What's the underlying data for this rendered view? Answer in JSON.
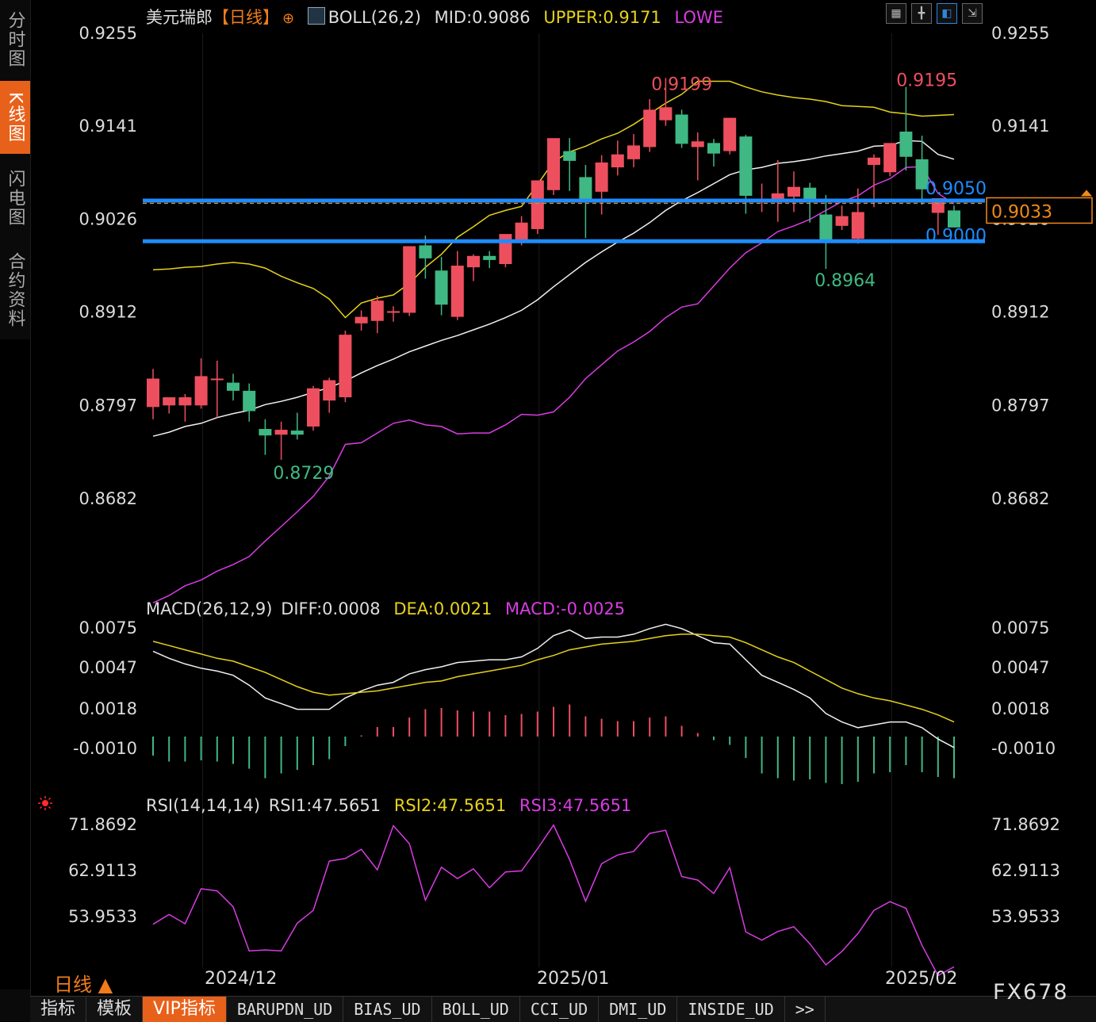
{
  "sidebar": {
    "tabs": [
      {
        "label": "分时图",
        "active": false
      },
      {
        "label": "K线图",
        "active": true
      },
      {
        "label": "闪电图",
        "active": false
      },
      {
        "label": "合约资料",
        "active": false
      }
    ]
  },
  "header": {
    "symbol": "美元瑞郎",
    "period_tag": "【日线】",
    "boll": "BOLL(26,2)",
    "mid": "MID:0.9086",
    "upper": "UPPER:0.9171",
    "lower": "LOWE"
  },
  "macd_legend": {
    "name": "MACD(26,12,9)",
    "diff": "DIFF:0.0008",
    "dea": "DEA:0.0021",
    "macd": "MACD:-0.0025"
  },
  "rsi_legend": {
    "name": "RSI(14,14,14)",
    "rsi1": "RSI1:47.5651",
    "rsi2": "RSI2:47.5651",
    "rsi3": "RSI3:47.5651"
  },
  "toolbar_icons": [
    "grid-icon",
    "crosshair-icon",
    "chart-mode-icon",
    "exit-fullscreen-icon"
  ],
  "bottom_tabs": [
    "指标",
    "模板",
    "VIP指标",
    "BARUPDN_UD",
    "BIAS_UD",
    "BOLL_UD",
    "CCI_UD",
    "DMI_UD",
    "INSIDE_UD",
    ">>"
  ],
  "period_label": "日线 ▲",
  "brand": "FX678",
  "colors": {
    "up": "#ee4f5e",
    "down": "#3fb883",
    "upper": "#e6d21a",
    "mid": "#f0f0f0",
    "lower": "#d93ce3",
    "hline": "#1e8cff",
    "accent": "#e8611a"
  },
  "chart_data": [
    {
      "type": "candlestick",
      "title": "美元瑞郎 日线",
      "y_ticks": [
        0.9255,
        0.9141,
        0.9026,
        0.8912,
        0.8797,
        0.8682
      ],
      "ylim": [
        0.8565,
        0.9255
      ],
      "x_labels": [
        "2024/12",
        "2025/01",
        "2025/02"
      ],
      "candles": [
        [
          0.8794,
          0.8841,
          0.8779,
          0.8829
        ],
        [
          0.8796,
          0.8804,
          0.8786,
          0.8806
        ],
        [
          0.8796,
          0.881,
          0.8776,
          0.8806
        ],
        [
          0.8796,
          0.8854,
          0.8792,
          0.8832
        ],
        [
          0.8828,
          0.8851,
          0.8781,
          0.8829
        ],
        [
          0.8824,
          0.8835,
          0.8802,
          0.8814
        ],
        [
          0.8814,
          0.8823,
          0.8776,
          0.8789
        ],
        [
          0.8767,
          0.8779,
          0.8735,
          0.8759
        ],
        [
          0.876,
          0.8776,
          0.8729,
          0.8766
        ],
        [
          0.8765,
          0.8787,
          0.8754,
          0.876
        ],
        [
          0.877,
          0.882,
          0.8765,
          0.8817
        ],
        [
          0.8802,
          0.883,
          0.8787,
          0.8827
        ],
        [
          0.8806,
          0.8888,
          0.88,
          0.8883
        ],
        [
          0.8897,
          0.8913,
          0.8888,
          0.8905
        ],
        [
          0.89,
          0.8931,
          0.8885,
          0.8925
        ],
        [
          0.891,
          0.8918,
          0.8899,
          0.8912
        ],
        [
          0.891,
          0.8978,
          0.8906,
          0.8992
        ],
        [
          0.8993,
          0.9005,
          0.8952,
          0.8977
        ],
        [
          0.8962,
          0.8979,
          0.8907,
          0.892
        ],
        [
          0.8905,
          0.8986,
          0.8901,
          0.8968
        ],
        [
          0.8966,
          0.8982,
          0.8949,
          0.898
        ],
        [
          0.898,
          0.8986,
          0.8965,
          0.8975
        ],
        [
          0.897,
          0.9002,
          0.8966,
          0.9007
        ],
        [
          0.9,
          0.9029,
          0.8993,
          0.9021
        ],
        [
          0.9013,
          0.9053,
          0.9007,
          0.9073
        ],
        [
          0.9061,
          0.912,
          0.9055,
          0.9125
        ],
        [
          0.9109,
          0.9125,
          0.906,
          0.9097
        ],
        [
          0.9077,
          0.9092,
          0.9002,
          0.905
        ],
        [
          0.9059,
          0.9104,
          0.9031,
          0.9095
        ],
        [
          0.9089,
          0.9122,
          0.9079,
          0.9105
        ],
        [
          0.9099,
          0.913,
          0.9089,
          0.9116
        ],
        [
          0.9114,
          0.9173,
          0.9108,
          0.916
        ],
        [
          0.9147,
          0.9199,
          0.914,
          0.9163
        ],
        [
          0.9154,
          0.916,
          0.9113,
          0.9118
        ],
        [
          0.9114,
          0.9132,
          0.9073,
          0.9121
        ],
        [
          0.9119,
          0.9124,
          0.909,
          0.9106
        ],
        [
          0.9109,
          0.915,
          0.9105,
          0.915
        ],
        [
          0.9127,
          0.9129,
          0.9032,
          0.9054
        ],
        [
          0.9047,
          0.9069,
          0.9034,
          0.9049
        ],
        [
          0.9046,
          0.9098,
          0.9022,
          0.9057
        ],
        [
          0.9053,
          0.9084,
          0.9034,
          0.9065
        ],
        [
          0.9064,
          0.907,
          0.9021,
          0.905
        ],
        [
          0.9031,
          0.9055,
          0.8964,
          0.9
        ],
        [
          0.9017,
          0.9042,
          0.9012,
          0.9029
        ],
        [
          0.9001,
          0.9063,
          0.8995,
          0.9034
        ],
        [
          0.9092,
          0.9105,
          0.904,
          0.9101
        ],
        [
          0.9083,
          0.9108,
          0.9078,
          0.9119
        ],
        [
          0.9133,
          0.9188,
          0.9085,
          0.9102
        ],
        [
          0.9099,
          0.9128,
          0.9043,
          0.9062
        ],
        [
          0.9033,
          0.9051,
          0.9006,
          0.9051
        ],
        [
          0.9036,
          0.9042,
          0.9018,
          0.9015
        ]
      ],
      "boll_upper": [
        0.8963,
        0.8964,
        0.8966,
        0.8967,
        0.897,
        0.8972,
        0.897,
        0.8965,
        0.8955,
        0.8947,
        0.894,
        0.8927,
        0.8904,
        0.8922,
        0.8928,
        0.8932,
        0.8946,
        0.8966,
        0.8982,
        0.9003,
        0.9016,
        0.903,
        0.9036,
        0.9041,
        0.9068,
        0.9096,
        0.9108,
        0.9115,
        0.9124,
        0.9131,
        0.9142,
        0.9155,
        0.9168,
        0.9179,
        0.9195,
        0.9195,
        0.9195,
        0.9188,
        0.9182,
        0.9178,
        0.9175,
        0.9173,
        0.917,
        0.9165,
        0.9164,
        0.9163,
        0.9157,
        0.9155,
        0.9152,
        0.9153,
        0.9154
      ],
      "boll_mid": [
        0.8758,
        0.8763,
        0.877,
        0.8774,
        0.8781,
        0.8786,
        0.879,
        0.8797,
        0.8801,
        0.8806,
        0.8812,
        0.8818,
        0.8826,
        0.8836,
        0.8845,
        0.8853,
        0.8862,
        0.8869,
        0.8876,
        0.8882,
        0.8889,
        0.8896,
        0.8904,
        0.8913,
        0.8926,
        0.8942,
        0.8957,
        0.8972,
        0.8985,
        0.8997,
        0.9008,
        0.9021,
        0.9036,
        0.9048,
        0.9058,
        0.9069,
        0.908,
        0.9086,
        0.9089,
        0.9094,
        0.9096,
        0.9099,
        0.9103,
        0.9106,
        0.9109,
        0.9115,
        0.9116,
        0.9122,
        0.9121,
        0.9105,
        0.9099
      ]
    },
    {
      "type": "line",
      "title": "MACD(26,12,9)",
      "y_ticks": [
        0.0075,
        0.0047,
        0.0018,
        -0.001
      ],
      "diff": [
        0.0058,
        0.0053,
        0.0049,
        0.0046,
        0.0044,
        0.0041,
        0.0034,
        0.0025,
        0.0021,
        0.0017,
        0.0017,
        0.0017,
        0.0025,
        0.003,
        0.0034,
        0.0036,
        0.0042,
        0.0045,
        0.0047,
        0.005,
        0.0051,
        0.0052,
        0.0052,
        0.0054,
        0.006,
        0.0069,
        0.0073,
        0.0067,
        0.0068,
        0.0068,
        0.007,
        0.0074,
        0.0077,
        0.0074,
        0.0069,
        0.0064,
        0.0063,
        0.0052,
        0.0041,
        0.0036,
        0.0031,
        0.0025,
        0.0014,
        0.0008,
        0.0004,
        0.0006,
        0.0008,
        0.0008,
        0.0004,
        -0.0004,
        -0.001
      ],
      "dea": [
        0.0065,
        0.0062,
        0.0059,
        0.0056,
        0.0053,
        0.0051,
        0.0047,
        0.0043,
        0.0038,
        0.0033,
        0.0029,
        0.0027,
        0.0028,
        0.0029,
        0.003,
        0.0032,
        0.0034,
        0.0036,
        0.0037,
        0.004,
        0.0042,
        0.0044,
        0.0046,
        0.0048,
        0.0052,
        0.0055,
        0.0059,
        0.0061,
        0.0063,
        0.0064,
        0.0065,
        0.0067,
        0.0069,
        0.007,
        0.007,
        0.0069,
        0.0068,
        0.0064,
        0.0059,
        0.0054,
        0.005,
        0.0044,
        0.0038,
        0.0032,
        0.0028,
        0.0025,
        0.0023,
        0.002,
        0.0017,
        0.0013,
        0.0008
      ],
      "hist": [
        -0.0016,
        -0.0021,
        -0.0021,
        -0.002,
        -0.0021,
        -0.0023,
        -0.0027,
        -0.0035,
        -0.0031,
        -0.0028,
        -0.0024,
        -0.0019,
        -0.0008,
        0.0001,
        0.0008,
        0.0008,
        0.0016,
        0.0023,
        0.0024,
        0.0022,
        0.0021,
        0.0021,
        0.0018,
        0.0019,
        0.0021,
        0.0025,
        0.0027,
        0.0017,
        0.0015,
        0.0013,
        0.0013,
        0.0016,
        0.0017,
        0.0009,
        0.0003,
        -0.0003,
        -0.0007,
        -0.0018,
        -0.0031,
        -0.0035,
        -0.0037,
        -0.0036,
        -0.0039,
        -0.004,
        -0.0038,
        -0.0031,
        -0.003,
        -0.0024,
        -0.003,
        -0.0034,
        -0.0035
      ]
    },
    {
      "type": "line",
      "title": "RSI(14,14,14)",
      "y_ticks": [
        71.8692,
        62.9113,
        53.9533
      ],
      "rsi": [
        52.3,
        54.2,
        52.4,
        59.2,
        58.8,
        55.7,
        47.1,
        47.3,
        47.1,
        52.5,
        55.0,
        64.6,
        65.1,
        66.9,
        62.9,
        71.5,
        68.0,
        57.0,
        63.4,
        61.2,
        63.1,
        59.4,
        62.5,
        62.7,
        67.0,
        71.6,
        64.9,
        56.8,
        64.1,
        65.8,
        66.5,
        70.0,
        70.6,
        61.6,
        60.9,
        58.3,
        63.3,
        50.8,
        49.2,
        50.9,
        51.8,
        48.5,
        44.4,
        47.0,
        50.5,
        55.0,
        56.7,
        55.4,
        48.2,
        42.3,
        44.0
      ]
    }
  ],
  "annotations": {
    "high1": "0.9199",
    "high2": "0.9195",
    "low1": "0.8729",
    "low2": "0.8964",
    "line1": "0.9050",
    "line2": "0.9000",
    "last_price": "0.9033",
    "hidden_tag": "0.9026"
  }
}
